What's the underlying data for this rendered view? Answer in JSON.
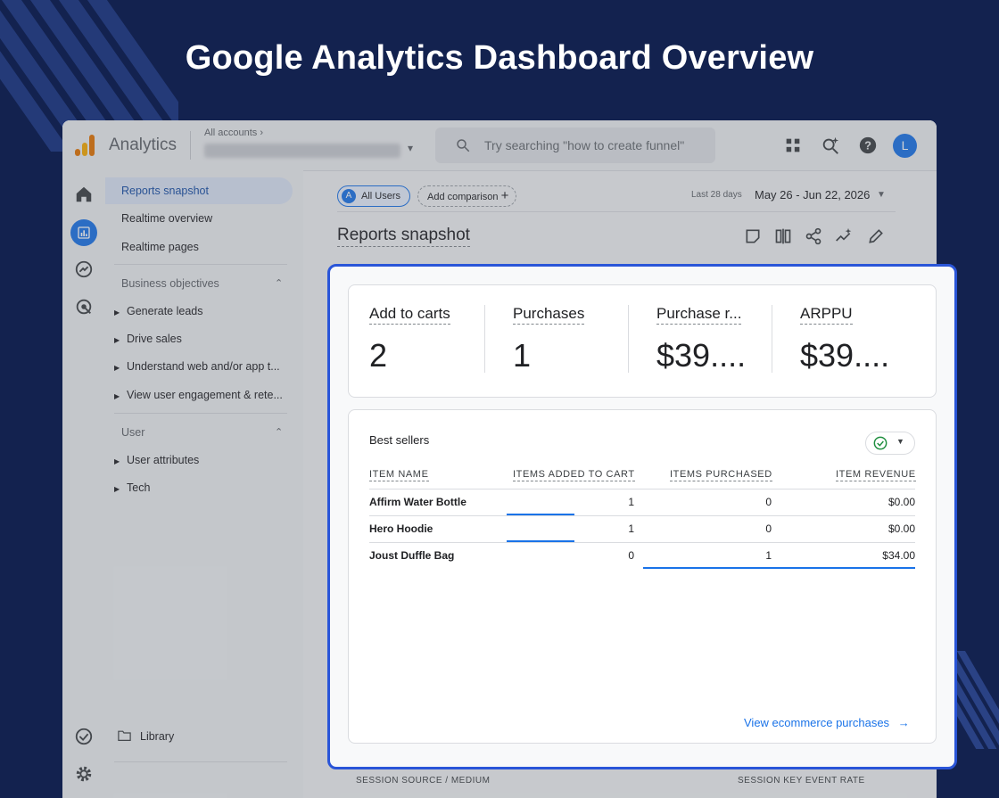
{
  "page_title": "Google Analytics Dashboard Overview",
  "topbar": {
    "app_name": "Analytics",
    "account_crumb": "All accounts",
    "search_placeholder": "Try searching \"how to create funnel\"",
    "avatar_letter": "L"
  },
  "nav": {
    "items": [
      "Reports snapshot",
      "Realtime overview",
      "Realtime pages"
    ],
    "section_business": "Business objectives",
    "business_items": [
      "Generate leads",
      "Drive sales",
      "Understand web and/or app t...",
      "View user engagement & rete..."
    ],
    "section_user": "User",
    "user_items": [
      "User attributes",
      "Tech"
    ],
    "library": "Library"
  },
  "main": {
    "chip_all_users": "All Users",
    "chip_letter": "A",
    "add_comparison": "Add comparison",
    "date_label": "Last 28 days",
    "date_range": "May 26 - Jun 22, 2026",
    "snapshot_title": "Reports snapshot",
    "bottom_col_left": "SESSION SOURCE / MEDIUM",
    "bottom_col_right": "SESSION KEY EVENT RATE"
  },
  "kpis": [
    {
      "label": "Add to carts",
      "value": "2"
    },
    {
      "label": "Purchases",
      "value": "1"
    },
    {
      "label": "Purchase r...",
      "value": "$39...."
    },
    {
      "label": "ARPPU",
      "value": "$39...."
    }
  ],
  "best_sellers": {
    "title": "Best sellers",
    "columns": [
      "ITEM NAME",
      "ITEMS ADDED TO CART",
      "ITEMS PURCHASED",
      "ITEM REVENUE"
    ],
    "rows": [
      {
        "name": "Affirm Water Bottle",
        "added": "1",
        "purchased": "0",
        "revenue": "$0.00"
      },
      {
        "name": "Hero Hoodie",
        "added": "1",
        "purchased": "0",
        "revenue": "$0.00"
      },
      {
        "name": "Joust Duffle Bag",
        "added": "0",
        "purchased": "1",
        "revenue": "$34.00"
      }
    ],
    "view_link": "View ecommerce purchases"
  },
  "colors": {
    "background": "#13224f",
    "accent": "#1a73e8",
    "highlight_border": "#2a55d8"
  }
}
